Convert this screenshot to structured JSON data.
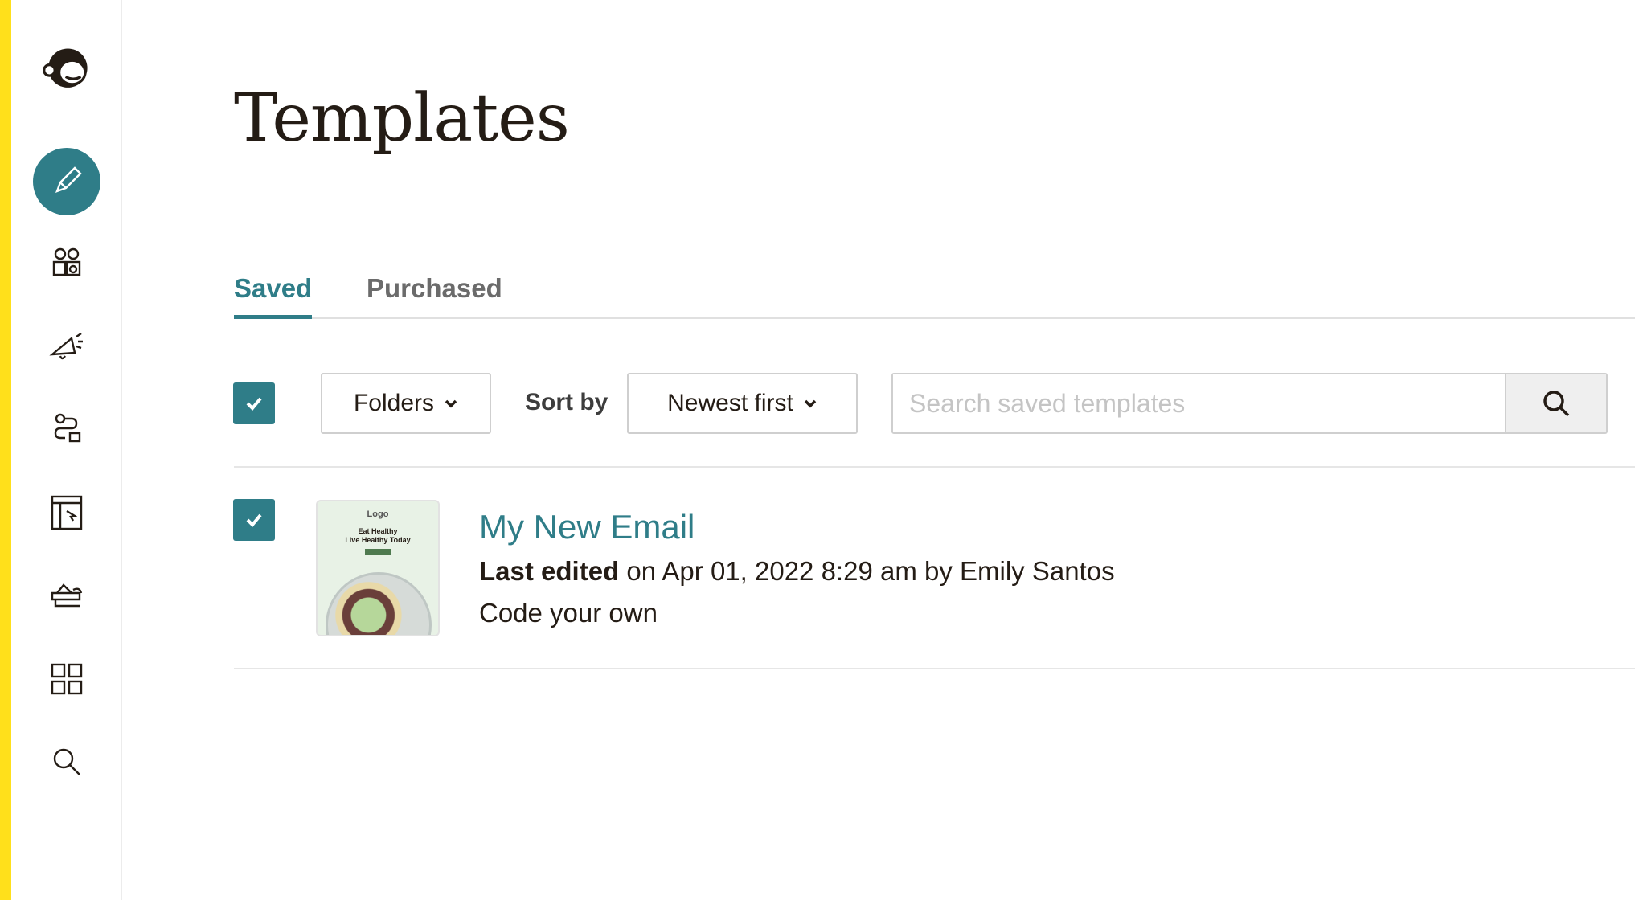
{
  "sidebar": {
    "items": [
      {
        "icon": "mailchimp-logo-icon"
      },
      {
        "icon": "pencil-icon",
        "active": true
      },
      {
        "icon": "audience-icon"
      },
      {
        "icon": "megaphone-icon"
      },
      {
        "icon": "automation-icon"
      },
      {
        "icon": "website-icon"
      },
      {
        "icon": "content-studio-icon"
      },
      {
        "icon": "integrations-grid-icon"
      },
      {
        "icon": "search-icon"
      }
    ]
  },
  "page": {
    "title": "Templates"
  },
  "tabs": [
    {
      "label": "Saved",
      "selected": true
    },
    {
      "label": "Purchased",
      "selected": false
    }
  ],
  "toolbar": {
    "select_all_checked": true,
    "folders_label": "Folders",
    "sort_label": "Sort by",
    "sort_value": "Newest first",
    "search_placeholder": "Search saved templates"
  },
  "templates": [
    {
      "checked": true,
      "name": "My New Email",
      "edited_label": "Last edited",
      "edited_rest": " on Apr 01, 2022 8:29 am by Emily Santos",
      "type": "Code your own",
      "thumbnail": {
        "logo": "Logo",
        "headline1": "Eat Healthy",
        "headline2": "Live Healthy Today"
      }
    }
  ],
  "colors": {
    "accent": "#2f7d88",
    "brand_yellow": "#ffe01b"
  }
}
